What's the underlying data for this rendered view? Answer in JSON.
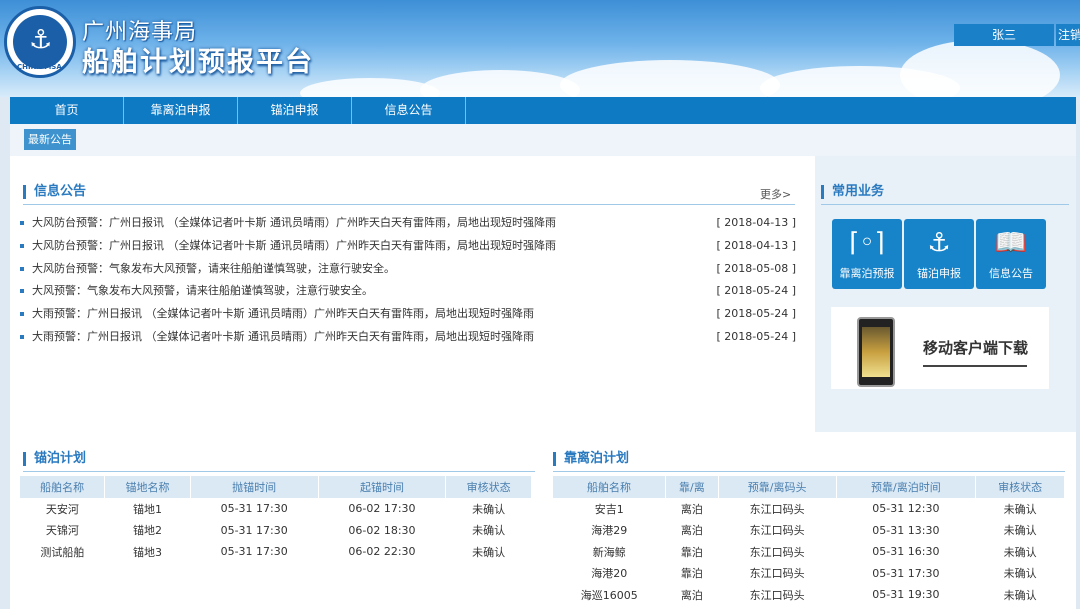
{
  "header": {
    "logo_text": "CHINA MSA",
    "title_line1": "广州海事局",
    "title_line2": "船舶计划预报平台",
    "user_name": "张三",
    "logout_label": "注销"
  },
  "nav": {
    "items": [
      "首页",
      "靠离泊申报",
      "锚泊申报",
      "信息公告"
    ]
  },
  "subbar": {
    "tab_label": "最新公告"
  },
  "news": {
    "title": "信息公告",
    "more_label": "更多>",
    "items": [
      {
        "text": "大风防台预警：广州日报讯 （全媒体记者叶卡斯 通讯员晴雨）广州昨天白天有雷阵雨，局地出现短时强降雨",
        "date": "[ 2018-04-13 ]"
      },
      {
        "text": "大风防台预警：广州日报讯 （全媒体记者叶卡斯 通讯员晴雨）广州昨天白天有雷阵雨，局地出现短时强降雨",
        "date": "[ 2018-04-13 ]"
      },
      {
        "text": "大风防台预警：气象发布大风预警，请来往船舶谨慎驾驶，注意行驶安全。",
        "date": "[ 2018-05-08 ]"
      },
      {
        "text": "大风预警：气象发布大风预警，请来往船舶谨慎驾驶，注意行驶安全。",
        "date": "[ 2018-05-24 ]"
      },
      {
        "text": "大雨预警：广州日报讯 （全媒体记者叶卡斯 通讯员晴雨）广州昨天白天有雷阵雨，局地出现短时强降雨",
        "date": "[ 2018-05-24 ]"
      },
      {
        "text": "大雨预警：广州日报讯 （全媒体记者叶卡斯 通讯员晴雨）广州昨天白天有雷阵雨，局地出现短时强降雨",
        "date": "[ 2018-05-24 ]"
      }
    ]
  },
  "services": {
    "title": "常用业务",
    "items": [
      {
        "label": "靠离泊预报",
        "icon": "berth-icon"
      },
      {
        "label": "锚泊申报",
        "icon": "anchor-icon"
      },
      {
        "label": "信息公告",
        "icon": "book-icon"
      }
    ],
    "app_download": "移动客户端下载"
  },
  "anchor_plan": {
    "title": "锚泊计划",
    "headers": [
      "船舶名称",
      "锚地名称",
      "抛锚时间",
      "起锚时间",
      "审核状态"
    ],
    "rows": [
      [
        "天安河",
        "锚地1",
        "05-31 17:30",
        "06-02 17:30",
        "未确认"
      ],
      [
        "天锦河",
        "锚地2",
        "05-31 17:30",
        "06-02 18:30",
        "未确认"
      ],
      [
        "测试船舶",
        "锚地3",
        "05-31 17:30",
        "06-02 22:30",
        "未确认"
      ]
    ]
  },
  "berth_plan": {
    "title": "靠离泊计划",
    "headers": [
      "船舶名称",
      "靠/离",
      "预靠/离码头",
      "预靠/离泊时间",
      "审核状态"
    ],
    "rows": [
      [
        "安吉1",
        "离泊",
        "东江口码头",
        "05-31 12:30",
        "未确认"
      ],
      [
        "海港29",
        "离泊",
        "东江口码头",
        "05-31 13:30",
        "未确认"
      ],
      [
        "新海鲸",
        "靠泊",
        "东江口码头",
        "05-31 16:30",
        "未确认"
      ],
      [
        "海港20",
        "靠泊",
        "东江口码头",
        "05-31 17:30",
        "未确认"
      ],
      [
        "海巡16005",
        "离泊",
        "东江口码头",
        "05-31 19:30",
        "未确认"
      ]
    ]
  }
}
